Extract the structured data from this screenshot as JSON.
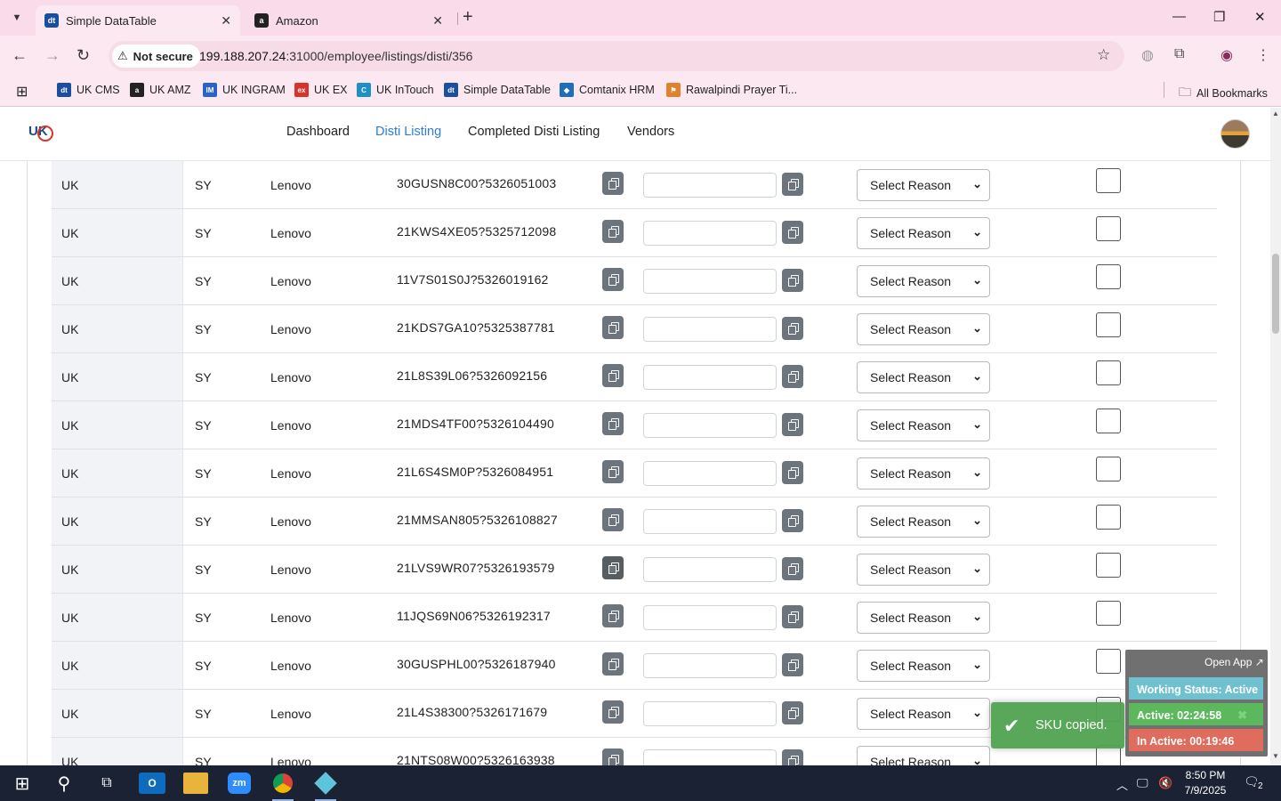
{
  "browser": {
    "tabs": [
      {
        "title": "Simple DataTable",
        "favicon": "dt",
        "favicon_color": "#1a4fa0",
        "active": true
      },
      {
        "title": "Amazon",
        "favicon": "a",
        "favicon_color": "#222222",
        "active": false
      }
    ],
    "security_label": "Not secure",
    "url_host": "199.188.207.24",
    "url_rest": ":31000/employee/listings/disti/356",
    "bookmarks": [
      {
        "label": "UK CMS",
        "icon": "dt",
        "color": "#1a4fa0"
      },
      {
        "label": "UK AMZ",
        "icon": "a",
        "color": "#222222"
      },
      {
        "label": "UK INGRAM",
        "icon": "IM",
        "color": "#2a62c9"
      },
      {
        "label": "UK EX",
        "icon": "ex",
        "color": "#d9322c"
      },
      {
        "label": "UK InTouch",
        "icon": "C",
        "color": "#1e90c8"
      },
      {
        "label": "Simple DataTable",
        "icon": "dt",
        "color": "#1a4fa0"
      },
      {
        "label": "Comtanix HRM",
        "icon": "◆",
        "color": "#1e6fb8"
      },
      {
        "label": "Rawalpindi Prayer Ti...",
        "icon": "⚑",
        "color": "#e0822c"
      }
    ],
    "all_bookmarks": "All Bookmarks"
  },
  "nav": {
    "links": [
      "Dashboard",
      "Disti Listing",
      "Completed Disti Listing",
      "Vendors"
    ],
    "active_index": 1,
    "logo_text": "UK"
  },
  "table": {
    "select_label": "Select Reason",
    "rows": [
      {
        "region": "UK",
        "code": "SY",
        "brand": "Lenovo",
        "sku": "30GUSN8C00?5326051003"
      },
      {
        "region": "UK",
        "code": "SY",
        "brand": "Lenovo",
        "sku": "21KWS4XE05?5325712098"
      },
      {
        "region": "UK",
        "code": "SY",
        "brand": "Lenovo",
        "sku": "11V7S01S0J?5326019162"
      },
      {
        "region": "UK",
        "code": "SY",
        "brand": "Lenovo",
        "sku": "21KDS7GA10?5325387781"
      },
      {
        "region": "UK",
        "code": "SY",
        "brand": "Lenovo",
        "sku": "21L8S39L06?5326092156"
      },
      {
        "region": "UK",
        "code": "SY",
        "brand": "Lenovo",
        "sku": "21MDS4TF00?5326104490"
      },
      {
        "region": "UK",
        "code": "SY",
        "brand": "Lenovo",
        "sku": "21L6S4SM0P?5326084951"
      },
      {
        "region": "UK",
        "code": "SY",
        "brand": "Lenovo",
        "sku": "21MMSAN805?5326108827"
      },
      {
        "region": "UK",
        "code": "SY",
        "brand": "Lenovo",
        "sku": "21LVS9WR07?5326193579"
      },
      {
        "region": "UK",
        "code": "SY",
        "brand": "Lenovo",
        "sku": "11JQS69N06?5326192317"
      },
      {
        "region": "UK",
        "code": "SY",
        "brand": "Lenovo",
        "sku": "30GUSPHL00?5326187940"
      },
      {
        "region": "UK",
        "code": "SY",
        "brand": "Lenovo",
        "sku": "21L4S38300?5326171679"
      },
      {
        "region": "UK",
        "code": "SY",
        "brand": "Lenovo",
        "sku": "21NTS08W00?5326163938"
      }
    ]
  },
  "toast": {
    "message": "SKU copied."
  },
  "widget": {
    "open_app": "Open App ↗",
    "status": "Working Status: Active",
    "active": "Active: 02:24:58",
    "inactive": "In Active: 00:19:46"
  },
  "taskbar": {
    "time": "8:50 PM",
    "date": "7/9/2025",
    "notification_count": "2"
  }
}
